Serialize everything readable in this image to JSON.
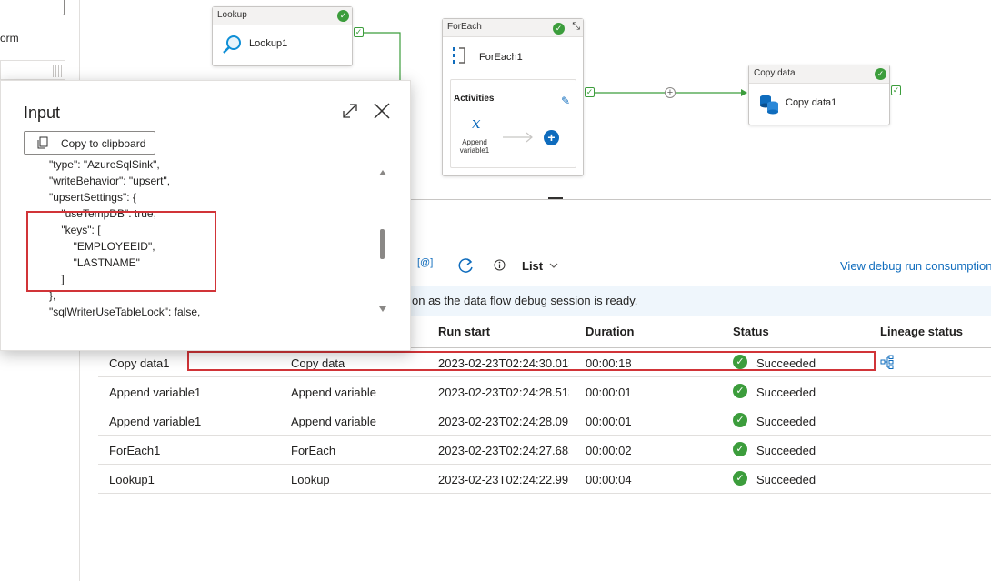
{
  "left_panel": {
    "label": "orm"
  },
  "pipeline": {
    "lookup": {
      "type": "Lookup",
      "name": "Lookup1"
    },
    "foreach": {
      "type": "ForEach",
      "name": "ForEach1",
      "activities_title": "Activities",
      "inner_activity": "Append\nvariable1"
    },
    "copy": {
      "type": "Copy data",
      "name": "Copy data1"
    }
  },
  "toolbar": {
    "view_label": "List",
    "link": "View debug run consumption"
  },
  "info_text": "on as the data flow debug session is ready.",
  "table": {
    "headers": {
      "run_start": "Run start",
      "duration": "Duration",
      "status": "Status",
      "lineage": "Lineage status"
    },
    "rows": [
      {
        "name": "Copy data1",
        "type": "Copy data",
        "run_start": "2023-02-23T02:24:30.013",
        "duration": "00:00:18",
        "status": "Succeeded"
      },
      {
        "name": "Append variable1",
        "type": "Append variable",
        "run_start": "2023-02-23T02:24:28.513",
        "duration": "00:00:01",
        "status": "Succeeded"
      },
      {
        "name": "Append variable1",
        "type": "Append variable",
        "run_start": "2023-02-23T02:24:28.091",
        "duration": "00:00:01",
        "status": "Succeeded"
      },
      {
        "name": "ForEach1",
        "type": "ForEach",
        "run_start": "2023-02-23T02:24:27.685",
        "duration": "00:00:02",
        "status": "Succeeded"
      },
      {
        "name": "Lookup1",
        "type": "Lookup",
        "run_start": "2023-02-23T02:24:22.991",
        "duration": "00:00:04",
        "status": "Succeeded"
      }
    ]
  },
  "dialog": {
    "title": "Input",
    "copy_button": "Copy to clipboard",
    "code_lines": [
      "\"type\": \"AzureSqlSink\",",
      "\"writeBehavior\": \"upsert\",",
      "\"upsertSettings\": {",
      "    \"useTempDB\": true,",
      "    \"keys\": [",
      "        \"EMPLOYEEID\",",
      "        \"LASTNAME\"",
      "    ]",
      "},",
      "\"sqlWriterUseTableLock\": false,"
    ]
  }
}
